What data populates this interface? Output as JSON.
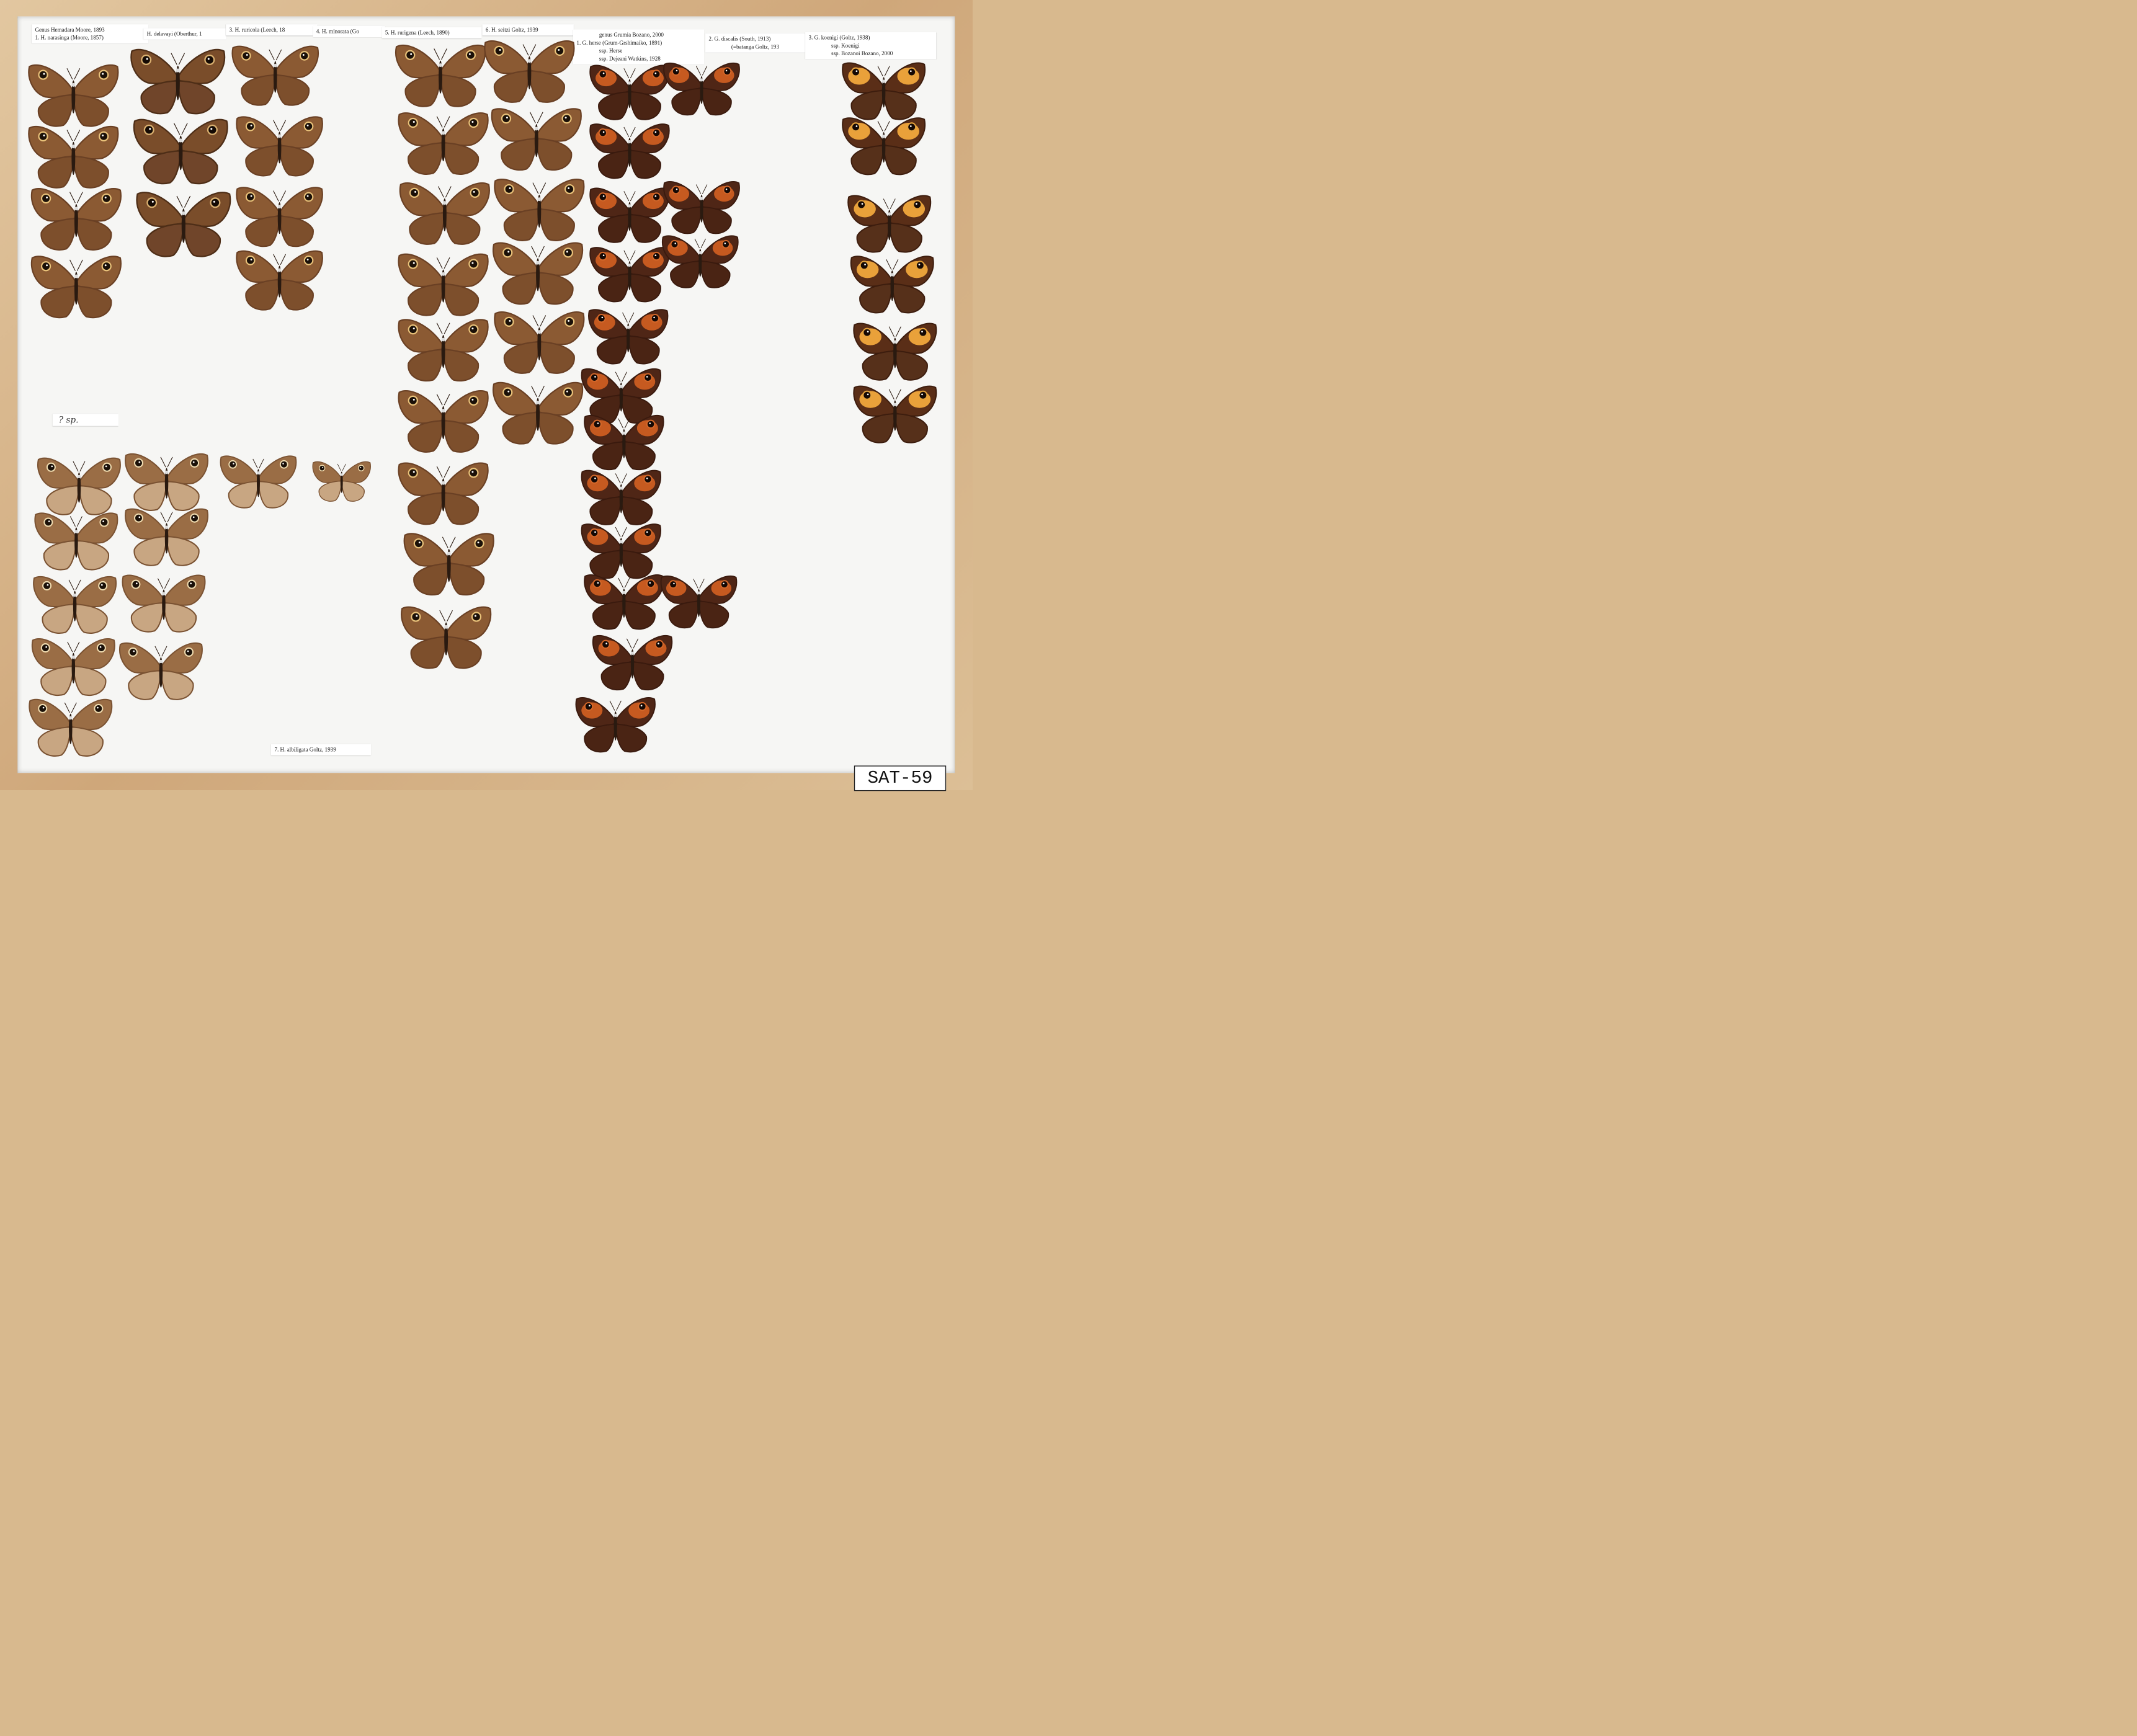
{
  "drawer_code": "SAT-59",
  "labels": {
    "genus_hemadara": "Genus Hemadara Moore, 1893",
    "sp1": "1.  H. narasinga (Moore, 1857)",
    "sp2": "H. delavayi (Oberthur, 1",
    "sp3": "3.  H. ruricola (Leech, 18",
    "sp4": "4.  H. minorata (Go",
    "sp5": "5.  H. rurigena (Leech, 1890)",
    "sp6": "6.  H. seitzi Goltz, 1939",
    "genus_grumia": "genus Grumia Bozano, 2000",
    "g1": "1. G. herse (Grum-Grshimaiko, 1891)",
    "g1_ssp1": "ssp. Herse",
    "g1_ssp2": "ssp. Dejeani Watkins, 1928",
    "g2": "2. G. discalis (South, 1913)",
    "g2_syn": "(=batanga Goltz, 193",
    "g3": "3. G. koenigi (Goltz, 1938)",
    "g3_ssp1": "ssp. Koenigi",
    "g3_ssp2": "ssp. Bozanoi Bozano, 2000",
    "sp7": "7.  H. albiligata Goltz, 1939",
    "unknown": "? sp."
  },
  "colors": {
    "frame_wood": "#d6b68a",
    "drawer_floor": "#f6f6f4",
    "brown_wing": "#8a5a32",
    "orange_patch": "#c25a1a",
    "yellow_patch": "#e8a63a"
  },
  "specimen_groups": [
    {
      "group": "H. narasinga",
      "count": 4,
      "color": "brown"
    },
    {
      "group": "H. delavayi",
      "count": 3,
      "color": "dark-brown"
    },
    {
      "group": "H. ruricola / H. minorata",
      "count": 4,
      "color": "brown"
    },
    {
      "group": "H. rurigena",
      "count": 9,
      "color": "brown"
    },
    {
      "group": "H. seitzi",
      "count": 6,
      "color": "brown"
    },
    {
      "group": "G. herse",
      "count": 12,
      "color": "orange-patch"
    },
    {
      "group": "G. discalis",
      "count": 4,
      "color": "orange-patch"
    },
    {
      "group": "G. koenigi",
      "count": 6,
      "color": "yellow-patch"
    },
    {
      "group": "? sp.",
      "count": 9,
      "color": "pale-brown"
    },
    {
      "group": "H. albiligata",
      "count": 2,
      "color": "pale-brown"
    }
  ]
}
